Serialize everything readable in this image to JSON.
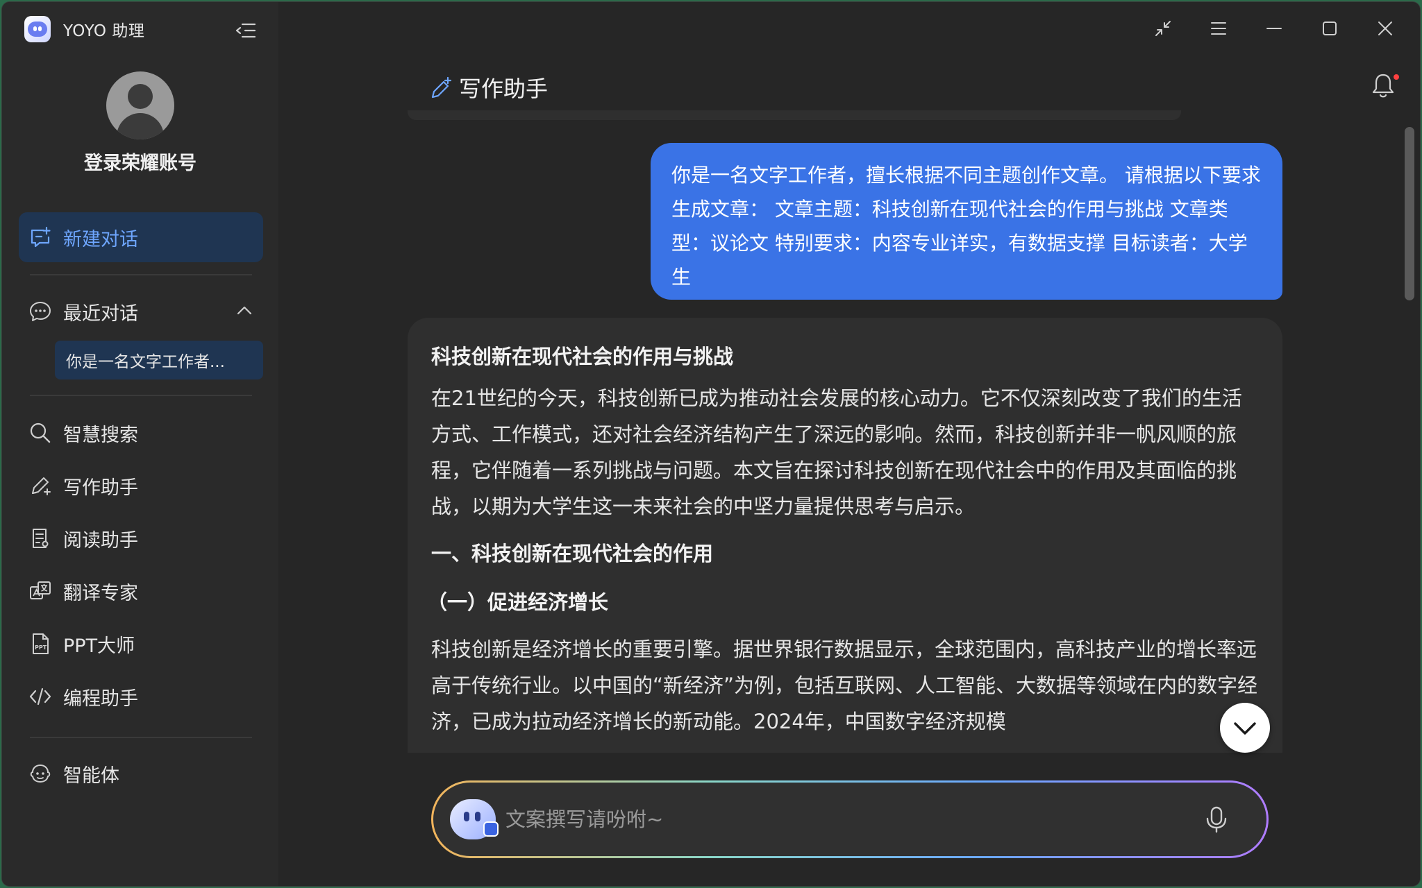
{
  "app": {
    "name": "YOYO 助理"
  },
  "sidebar": {
    "login_label": "登录荣耀账号",
    "new_chat_label": "新建对话",
    "recent_label": "最近对话",
    "recent_items": [
      {
        "label": "你是一名文字工作者..."
      }
    ],
    "nav_items": [
      {
        "label": "智慧搜索",
        "icon": "search-icon"
      },
      {
        "label": "写作助手",
        "icon": "pen-icon"
      },
      {
        "label": "阅读助手",
        "icon": "document-icon"
      },
      {
        "label": "翻译专家",
        "icon": "translate-icon"
      },
      {
        "label": "PPT大师",
        "icon": "ppt-icon"
      },
      {
        "label": "编程助手",
        "icon": "code-icon"
      }
    ],
    "agent_label": "智能体"
  },
  "main": {
    "title": "写作助手",
    "user_message": "你是一名文字工作者，擅长根据不同主题创作文章。 请根据以下要求生成文章： 文章主题：科技创新在现代社会的作用与挑战 文章类型：议论文 特别要求：内容专业详实，有数据支撑 目标读者：大学生",
    "ai_response": {
      "title": "科技创新在现代社会的作用与挑战",
      "intro": "在21世纪的今天，科技创新已成为推动社会发展的核心动力。它不仅深刻改变了我们的生活方式、工作模式，还对社会经济结构产生了深远的影响。然而，科技创新并非一帆风顺的旅程，它伴随着一系列挑战与问题。本文旨在探讨科技创新在现代社会中的作用及其面临的挑战，以期为大学生这一未来社会的中坚力量提供思考与启示。",
      "section1": "一、科技创新在现代社会的作用",
      "subsection1": "（一）促进经济增长",
      "paragraph1": "科技创新是经济增长的重要引擎。据世界银行数据显示，全球范围内，高科技产业的增长率远高于传统行业。以中国的“新经济”为例，包括互联网、人工智能、大数据等领域在内的数字经济，已成为拉动经济增长的新动能。2024年，中国数字经济规模"
    },
    "input_placeholder": "文案撰写请吩咐~"
  },
  "colors": {
    "accent": "#3a73e6",
    "accent_text": "#6ea6ff",
    "selected_bg": "#1f3552",
    "notification_dot": "#ff4040"
  }
}
